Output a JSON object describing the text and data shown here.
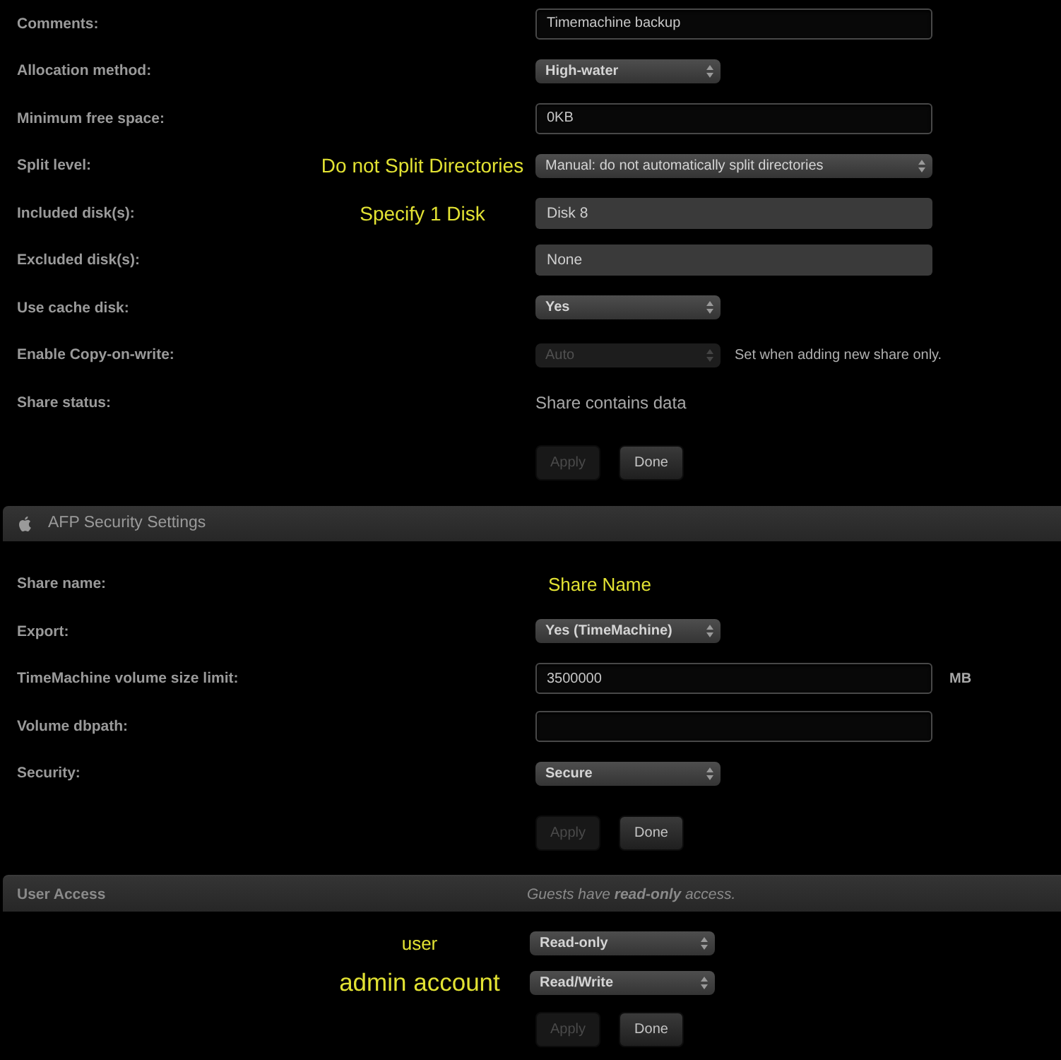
{
  "share_settings": {
    "rows": [
      {
        "label": "Comments:",
        "control": {
          "kind": "text",
          "value": "Timemachine backup"
        }
      },
      {
        "label": "Allocation method:",
        "control": {
          "kind": "select",
          "value": "High-water",
          "disabled": false
        }
      },
      {
        "label": "Minimum free space:",
        "control": {
          "kind": "text",
          "value": "0KB"
        }
      },
      {
        "label": "Split level:",
        "annotation": "Do not Split Directories",
        "control": {
          "kind": "wide_select",
          "value": "Manual: do not automatically split directories",
          "disabled": false
        }
      },
      {
        "label": "Included disk(s):",
        "annotation": "Specify 1 Disk",
        "control": {
          "kind": "picker",
          "value": "Disk 8"
        }
      },
      {
        "label": "Excluded disk(s):",
        "control": {
          "kind": "picker",
          "value": "None"
        }
      },
      {
        "label": "Use cache disk:",
        "control": {
          "kind": "select",
          "value": "Yes",
          "disabled": false
        }
      },
      {
        "label": "Enable Copy-on-write:",
        "control": {
          "kind": "select",
          "value": "Auto",
          "disabled": true
        },
        "hint": "Set when adding new share only."
      },
      {
        "label": "Share status:",
        "control": {
          "kind": "status",
          "value": "Share contains data"
        }
      }
    ],
    "buttons": [
      {
        "label": "Apply",
        "disabled": true
      },
      {
        "label": "Done",
        "disabled": false
      }
    ]
  },
  "afp_security": {
    "title": "AFP Security Settings",
    "rows": [
      {
        "label": "Share name:",
        "control": {
          "kind": "annotation",
          "value": "Share Name"
        }
      },
      {
        "label": "Export:",
        "control": {
          "kind": "select",
          "value": "Yes (TimeMachine)",
          "disabled": false
        }
      },
      {
        "label": "TimeMachine volume size limit:",
        "control": {
          "kind": "text",
          "value": "3500000"
        },
        "unit": "MB"
      },
      {
        "label": "Volume dbpath:",
        "control": {
          "kind": "text"
        }
      },
      {
        "label": "Security:",
        "control": {
          "kind": "select",
          "value": "Secure",
          "disabled": false
        }
      }
    ],
    "buttons": [
      {
        "label": "Apply",
        "disabled": true
      },
      {
        "label": "Done",
        "disabled": false
      }
    ]
  },
  "user_access": {
    "title": "User Access",
    "note": "Guests have **read-only** access.",
    "users": [
      {
        "name": "user",
        "access": "Read-only"
      },
      {
        "name": "admin account",
        "access": "Read/Write"
      }
    ],
    "buttons": [
      {
        "label": "Apply",
        "disabled": true
      },
      {
        "label": "Done",
        "disabled": false
      }
    ]
  }
}
